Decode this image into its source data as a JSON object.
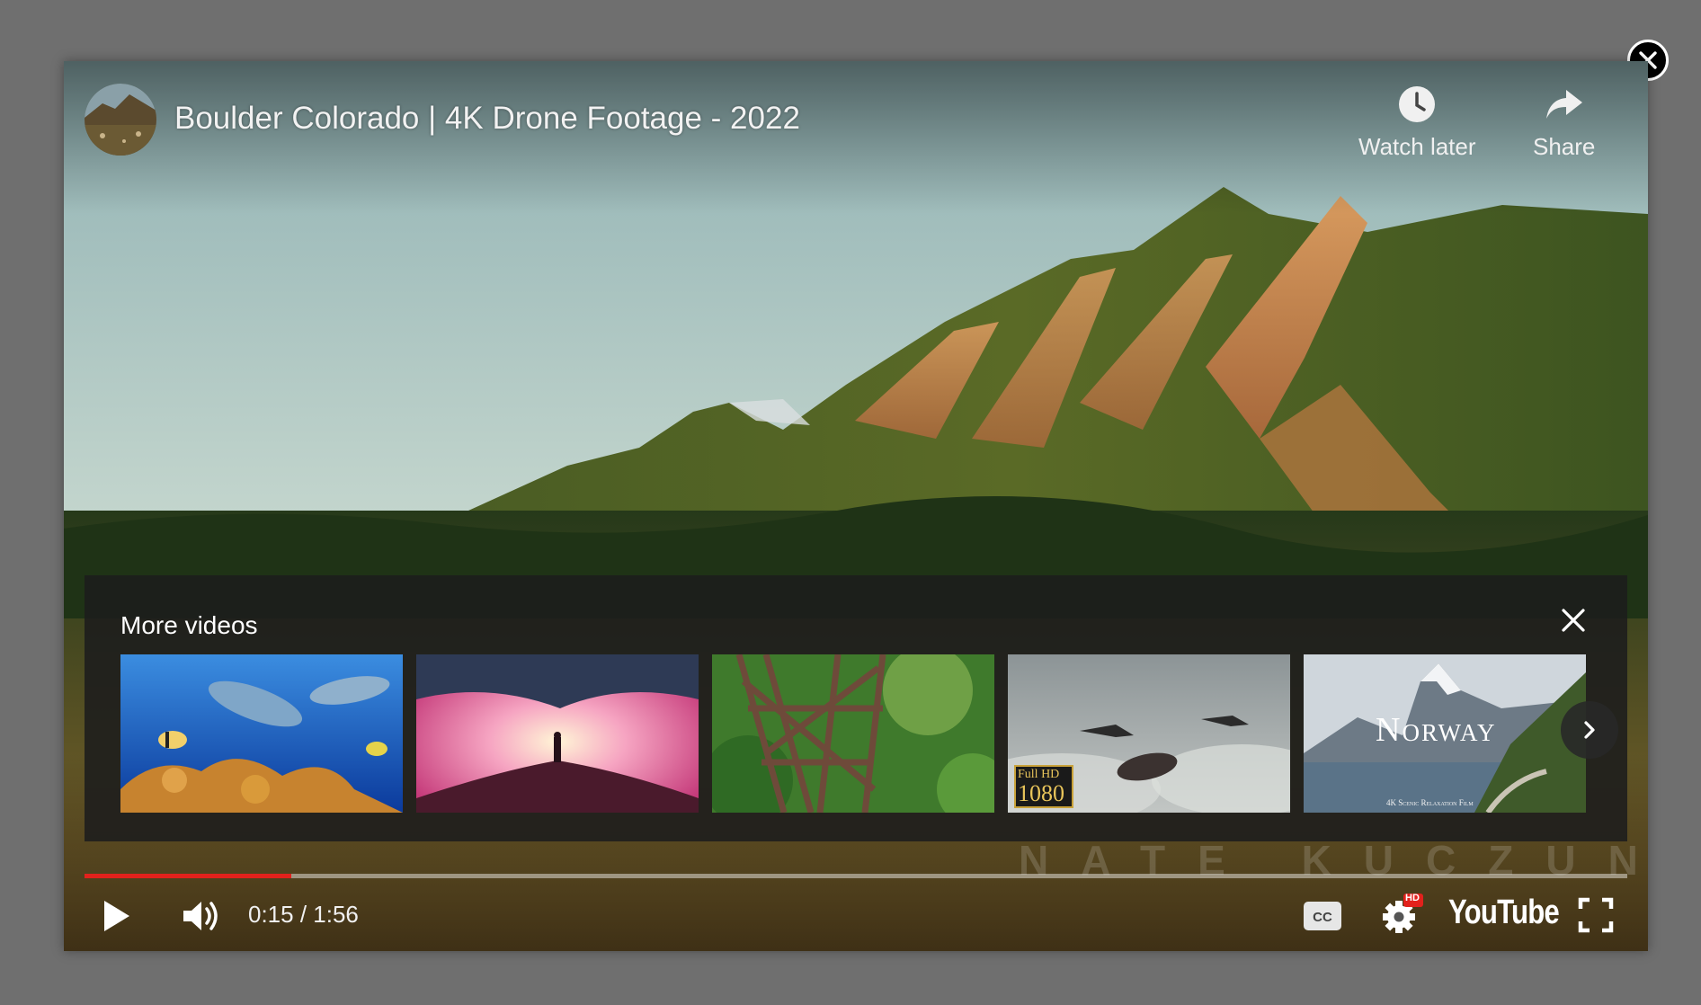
{
  "video": {
    "title": "Boulder Colorado | 4K Drone Footage - 2022",
    "watermark": "NATE KUCZUN"
  },
  "top_actions": {
    "watch_later_label": "Watch later",
    "share_label": "Share"
  },
  "more_videos": {
    "heading": "More videos",
    "thumbnails": [
      {
        "name": "underwater-dolphins-thumbnail",
        "badge_top": "",
        "badge_bottom": "",
        "overlay_title": "",
        "overlay_subtitle": ""
      },
      {
        "name": "fantasy-sky-thumbnail",
        "badge_top": "",
        "badge_bottom": "",
        "overlay_title": "",
        "overlay_subtitle": ""
      },
      {
        "name": "rusty-bridge-forest-thumbnail",
        "badge_top": "",
        "badge_bottom": "",
        "overlay_title": "",
        "overlay_subtitle": ""
      },
      {
        "name": "jets-clouds-thumbnail",
        "badge_top": "Full HD",
        "badge_bottom": "1080",
        "overlay_title": "",
        "overlay_subtitle": ""
      },
      {
        "name": "norway-thumbnail",
        "badge_top": "",
        "badge_bottom": "",
        "overlay_title": "Norway",
        "overlay_subtitle": "4K Scenic Relaxation Film"
      }
    ]
  },
  "playback": {
    "current_time": "0:15",
    "duration": "1:56",
    "time_display": "0:15 / 1:56",
    "progress_fraction": 0.134
  },
  "controls": {
    "settings_badge": "HD",
    "brand": "YouTube",
    "cc_label": "CC"
  },
  "colors": {
    "progress": "#e2211c",
    "hd_badge": "#e2211c"
  }
}
